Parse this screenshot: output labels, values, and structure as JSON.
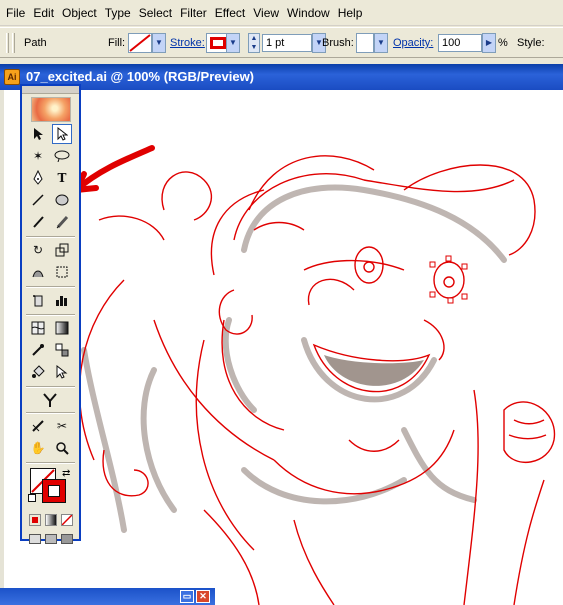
{
  "menubar": {
    "items": [
      {
        "label": "File"
      },
      {
        "label": "Edit"
      },
      {
        "label": "Object"
      },
      {
        "label": "Type"
      },
      {
        "label": "Select"
      },
      {
        "label": "Filter"
      },
      {
        "label": "Effect"
      },
      {
        "label": "View"
      },
      {
        "label": "Window"
      },
      {
        "label": "Help"
      }
    ]
  },
  "control": {
    "selection_type": "Path",
    "fill_label": "Fill:",
    "stroke_label": "Stroke:",
    "stroke_weight": "1 pt",
    "brush_label": "Brush:",
    "opacity_label": "Opacity:",
    "opacity_value": "100",
    "percent_sign": "%",
    "style_label": "Style:"
  },
  "document": {
    "title": "07_excited.ai @ 100% (RGB/Preview)",
    "icon_text": "Ai"
  },
  "colors": {
    "path_stroke": "#e00000",
    "sketch": "#8a7a72",
    "titlebar": "#1a4cc2",
    "stroke_swatch": "#e00000"
  },
  "toolbox": {
    "tools": [
      {
        "icon": "selection-arrow-icon"
      },
      {
        "icon": "direct-selection-icon"
      },
      {
        "icon": "magic-wand-icon"
      },
      {
        "icon": "lasso-icon"
      },
      {
        "icon": "pen-tool-icon"
      },
      {
        "icon": "type-tool-icon"
      },
      {
        "icon": "line-segment-icon"
      },
      {
        "icon": "rectangle-tool-icon"
      },
      {
        "icon": "paintbrush-icon"
      },
      {
        "icon": "pencil-icon"
      },
      {
        "icon": "rotate-tool-icon"
      },
      {
        "icon": "scale-tool-icon"
      },
      {
        "icon": "warp-tool-icon"
      },
      {
        "icon": "free-transform-icon"
      },
      {
        "icon": "symbol-sprayer-icon"
      },
      {
        "icon": "graph-tool-icon"
      },
      {
        "icon": "mesh-tool-icon"
      },
      {
        "icon": "gradient-tool-icon"
      },
      {
        "icon": "eyedropper-icon"
      },
      {
        "icon": "blend-tool-icon"
      },
      {
        "icon": "live-paint-bucket-icon"
      },
      {
        "icon": "live-paint-selection-icon"
      },
      {
        "icon": "slice-tool-icon"
      },
      {
        "icon": "eraser-icon"
      },
      {
        "icon": "scissors-icon"
      },
      {
        "icon": "hand-tool-icon"
      },
      {
        "icon": "zoom-tool-icon"
      }
    ]
  }
}
